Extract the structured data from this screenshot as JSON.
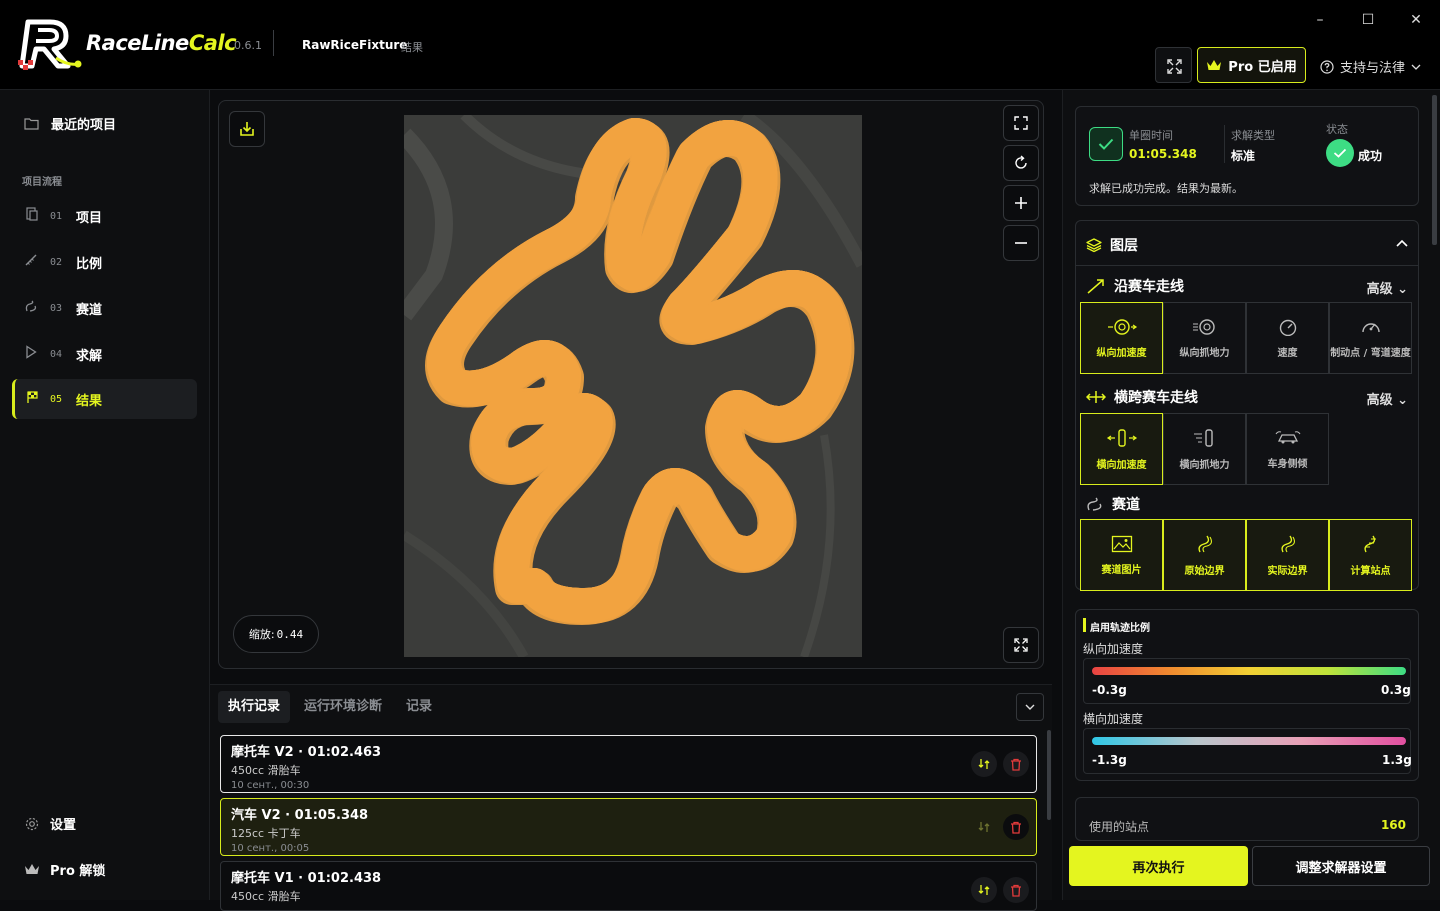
{
  "app": {
    "brand_part1": "RaceLine",
    "brand_part2": "Calc",
    "version": "0.6.1",
    "project_name": "RawRiceFixture",
    "project_sub": "结果"
  },
  "window": {
    "minimize": "–",
    "maximize": "☐",
    "close": "✕"
  },
  "header": {
    "pro_label": "Pro 已启用",
    "support_label": "支持与法律"
  },
  "sidebar": {
    "recent_projects": "最近的项目",
    "section_title": "项目流程",
    "items": [
      {
        "num": "01",
        "label": "项目"
      },
      {
        "num": "02",
        "label": "比例"
      },
      {
        "num": "03",
        "label": "赛道"
      },
      {
        "num": "04",
        "label": "求解"
      },
      {
        "num": "05",
        "label": "结果"
      }
    ],
    "settings": "设置",
    "pro_unlock": "Pro 解锁"
  },
  "viewer": {
    "zoom_label": "缩放:",
    "zoom_value": "0.44"
  },
  "runs_panel": {
    "tabs": [
      "执行记录",
      "运行环境诊断",
      "记录"
    ],
    "runs": [
      {
        "title": "摩托车 V2 · 01:02.463",
        "subtitle": "450cc 滑胎车",
        "date": "10 сент., 00:30"
      },
      {
        "title": "汽车 V2 · 01:05.348",
        "subtitle": "125cc 卡丁车",
        "date": "10 сент., 00:05"
      },
      {
        "title": "摩托车 V1 · 01:02.438",
        "subtitle": "450cc 滑胎车",
        "date": ""
      }
    ]
  },
  "summary": {
    "lap_time_label": "单圈时间",
    "lap_time": "01:05.348",
    "solve_type_label": "求解类型",
    "solve_type": "标准",
    "status_label": "状态",
    "status": "成功",
    "message": "求解已成功完成。结果为最新。"
  },
  "layers": {
    "title": "图层",
    "along": {
      "title": "沿赛车走线",
      "advanced": "高级",
      "tiles": [
        "纵向加速度",
        "纵向抓地力",
        "速度",
        "制动点 / 弯道速度"
      ]
    },
    "across": {
      "title": "横跨赛车走线",
      "advanced": "高级",
      "tiles": [
        "横向加速度",
        "横向抓地力",
        "车身侧倾"
      ]
    },
    "track": {
      "title": "赛道",
      "tiles": [
        "赛道图片",
        "原始边界",
        "实际边界",
        "计算站点"
      ]
    }
  },
  "scales": {
    "title": "启用轨迹比例",
    "longitudinal": {
      "label": "纵向加速度",
      "min": "-0.3g",
      "max": "0.3g"
    },
    "lateral": {
      "label": "横向加速度",
      "min": "-1.3g",
      "max": "1.3g"
    }
  },
  "stations": {
    "label": "使用的站点",
    "value": "160"
  },
  "actions": {
    "run_again": "再次执行",
    "adjust": "调整求解器设置"
  },
  "colors": {
    "accent": "#e4f51f",
    "success": "#3ddc84",
    "danger": "#e23b3b"
  }
}
